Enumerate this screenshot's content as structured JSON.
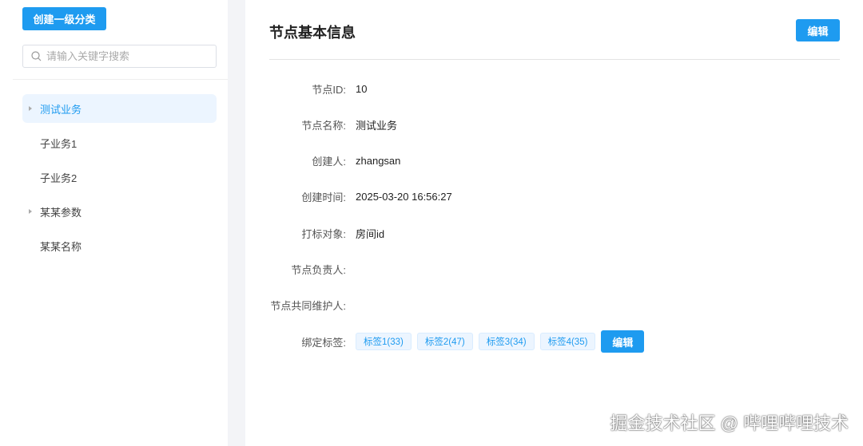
{
  "sidebar": {
    "create_label": "创建一级分类",
    "search_placeholder": "请输入关键字搜索",
    "items": [
      {
        "label": "测试业务"
      },
      {
        "label": "子业务1"
      },
      {
        "label": "子业务2"
      },
      {
        "label": "某某参数"
      },
      {
        "label": "某某名称"
      }
    ]
  },
  "main": {
    "title": "节点基本信息",
    "edit_label": "编辑",
    "fields": [
      {
        "label": "节点ID:",
        "value": "10"
      },
      {
        "label": "节点名称:",
        "value": "测试业务"
      },
      {
        "label": "创建人:",
        "value": "zhangsan"
      },
      {
        "label": "创建时间:",
        "value": "2025-03-20 16:56:27"
      },
      {
        "label": "打标对象:",
        "value": "房间id"
      },
      {
        "label": "节点负责人:",
        "value": ""
      },
      {
        "label": "节点共同维护人:",
        "value": ""
      }
    ],
    "tags_label": "绑定标签:",
    "tags": [
      "标签1(33)",
      "标签2(47)",
      "标签3(34)",
      "标签4(35)"
    ],
    "tags_edit_label": "编辑"
  },
  "watermark": "掘金技术社区 @ 哔哩哔哩技术"
}
